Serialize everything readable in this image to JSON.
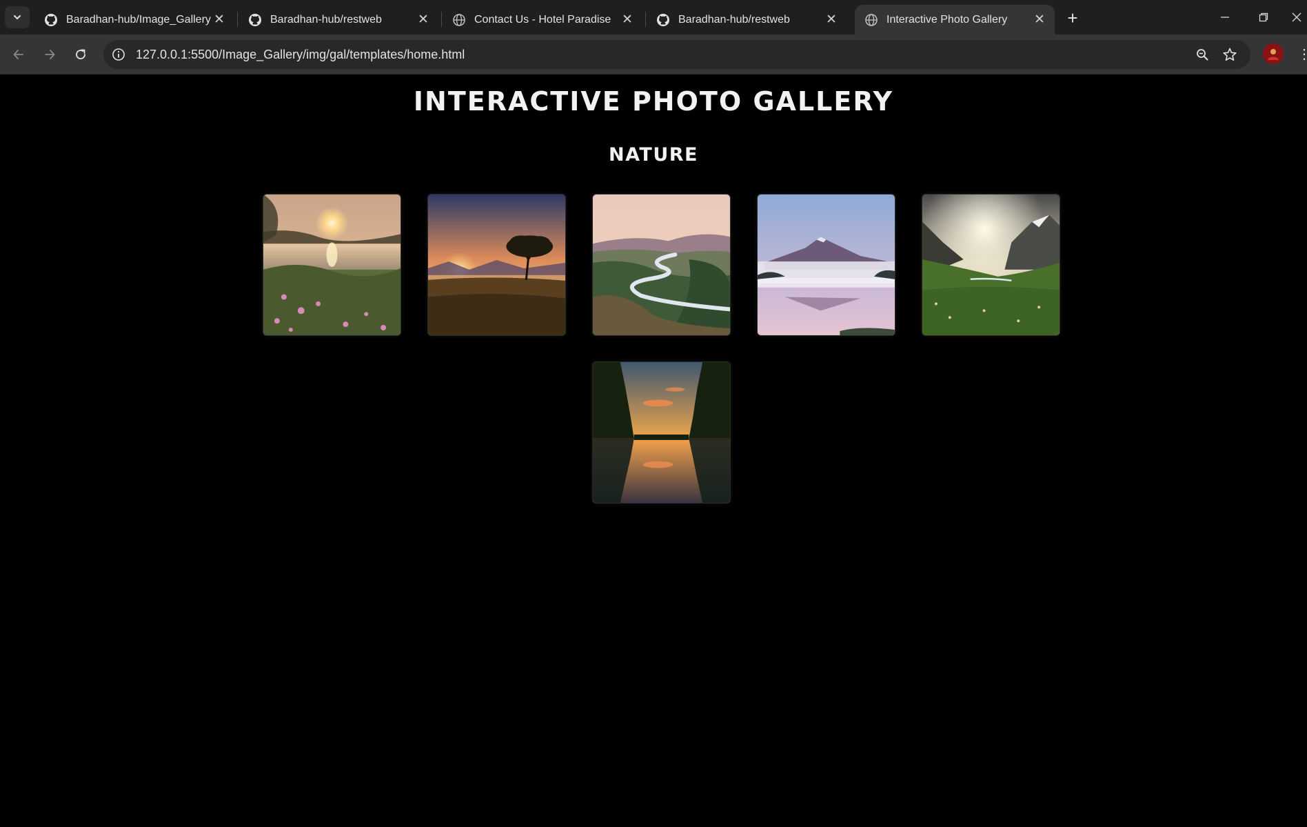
{
  "browser": {
    "tabs": [
      {
        "title": "Baradhan-hub/Image_Gallery",
        "icon": "github-icon"
      },
      {
        "title": "Baradhan-hub/restweb",
        "icon": "github-icon"
      },
      {
        "title": "Contact Us - Hotel Paradise",
        "icon": "globe-icon"
      },
      {
        "title": "Baradhan-hub/restweb",
        "icon": "github-icon"
      },
      {
        "title": "Interactive Photo Gallery",
        "icon": "globe-icon",
        "active": true
      }
    ],
    "url": "127.0.0.1:5500/Image_Gallery/img/gal/templates/home.html"
  },
  "page": {
    "title": "INTERACTIVE PHOTO GALLERY",
    "section": "NATURE"
  },
  "gallery": [
    {
      "subject": "sunset-over-lake-with-wildflowers"
    },
    {
      "subject": "lone-tree-at-sunset"
    },
    {
      "subject": "winding-river-valley"
    },
    {
      "subject": "misty-mountain-reflection"
    },
    {
      "subject": "sunlit-mountain-meadow"
    },
    {
      "subject": "forest-lake-sunset-reflection"
    }
  ],
  "colors": {
    "page_background": "#000000",
    "heading_text": "#f2f2f2",
    "chrome_dark": "#1f1f1f",
    "chrome_mid": "#353535"
  }
}
